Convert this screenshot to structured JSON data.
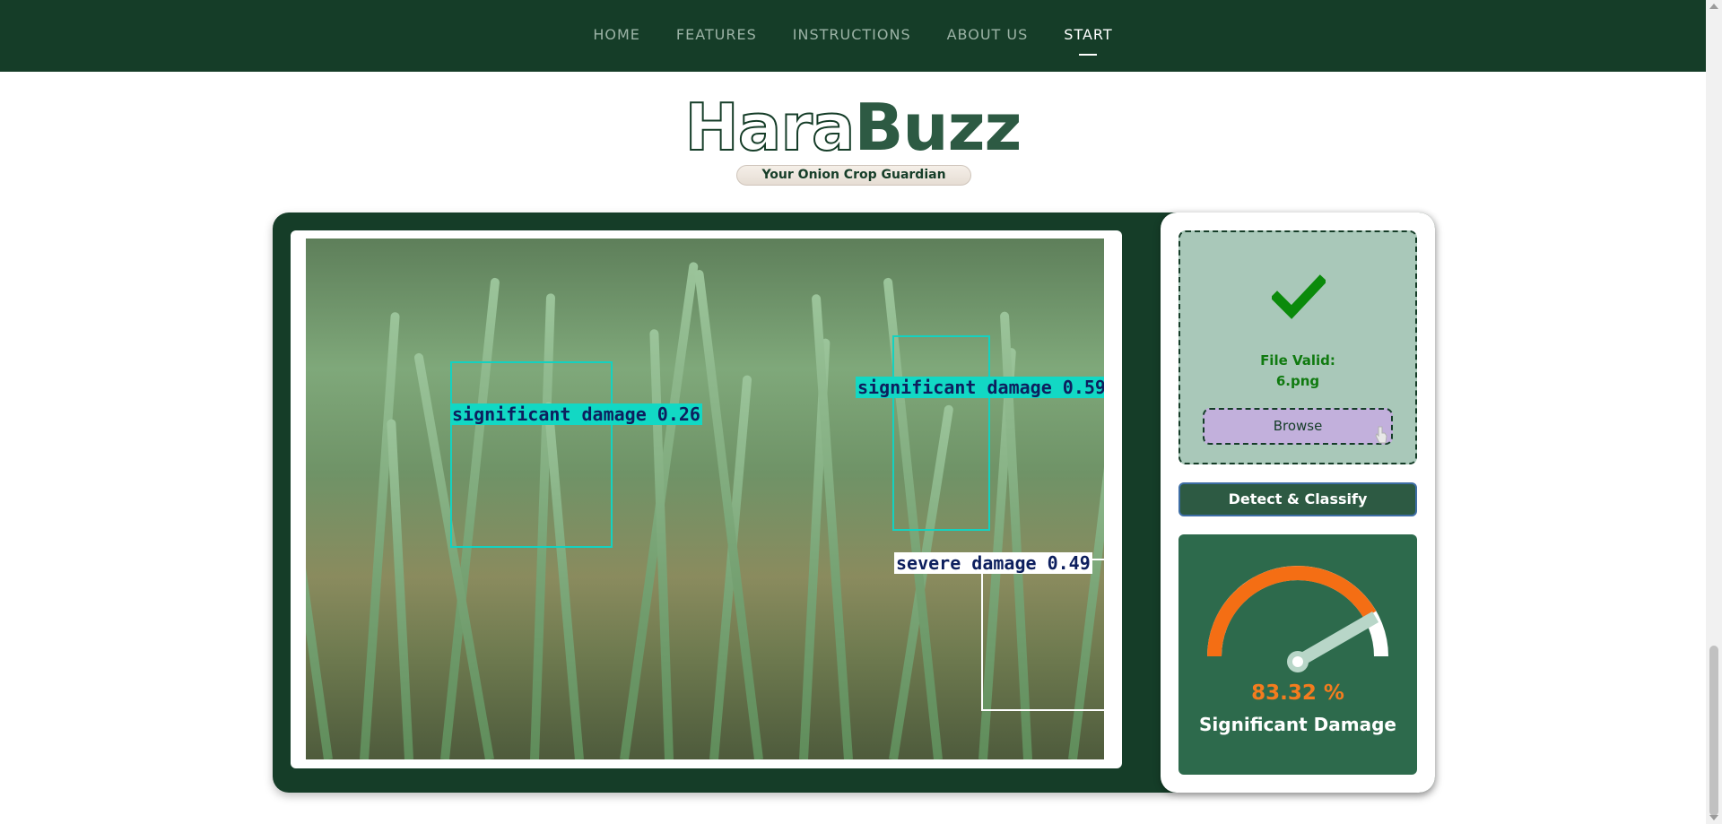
{
  "nav": {
    "items": [
      {
        "label": "HOME"
      },
      {
        "label": "FEATURES"
      },
      {
        "label": "INSTRUCTIONS"
      },
      {
        "label": "ABOUT US"
      },
      {
        "label": "START"
      }
    ],
    "active": "START"
  },
  "brand": {
    "logo_part1": "Hara",
    "logo_part2": "Buzz",
    "tagline": "Your Onion Crop Guardian"
  },
  "detections": [
    {
      "label": "significant damage 0.26"
    },
    {
      "label": "significant damage 0.59"
    },
    {
      "label": "severe damage 0.49"
    }
  ],
  "upload": {
    "status_line1": "File Valid:",
    "status_line2": "6.png",
    "browse_label": "Browse"
  },
  "actions": {
    "detect_label": "Detect & Classify"
  },
  "result": {
    "percent_text": "83.32 %",
    "percent_value": 83.32,
    "class_label": "Significant Damage"
  },
  "colors": {
    "nav_bg": "#153d28",
    "brand_dark": "#2d5a43",
    "accent_orange": "#f47c1e",
    "detection_cyan": "#14d2c0",
    "valid_green": "#107a10"
  },
  "icons": {
    "status": "checkmark-icon",
    "cursor": "pointer-cursor-icon"
  }
}
